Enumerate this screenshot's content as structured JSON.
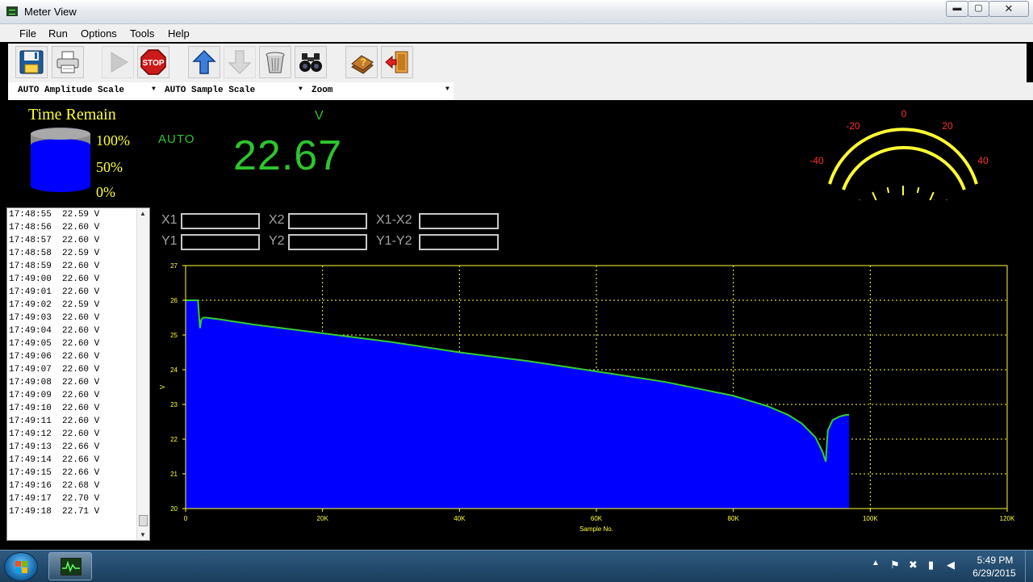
{
  "window": {
    "title": "Meter View",
    "minimize": "▬",
    "maximize": "▢",
    "close": "✕"
  },
  "menu": [
    "File",
    "Run",
    "Options",
    "Tools",
    "Help"
  ],
  "toolbar": [
    {
      "name": "save-button",
      "icon": "floppy-disk-icon",
      "enabled": true
    },
    {
      "name": "print-button",
      "icon": "printer-icon",
      "enabled": true
    },
    {
      "name": "play-button",
      "icon": "play-icon",
      "enabled": false
    },
    {
      "name": "stop-button",
      "icon": "stop-sign-icon",
      "enabled": true,
      "label": "STOP"
    },
    {
      "name": "upload-button",
      "icon": "arrow-up-icon",
      "enabled": true
    },
    {
      "name": "download-button",
      "icon": "arrow-down-icon",
      "enabled": false
    },
    {
      "name": "clear-button",
      "icon": "trash-can-icon",
      "enabled": true
    },
    {
      "name": "find-button",
      "icon": "binoculars-icon",
      "enabled": true
    },
    {
      "name": "help-book-button",
      "icon": "help-book-icon",
      "enabled": true
    },
    {
      "name": "exit-button",
      "icon": "exit-door-icon",
      "enabled": true
    }
  ],
  "scales": {
    "amplitude": "AUTO Amplitude Scale",
    "sample": "AUTO Sample Scale",
    "zoom": "Zoom"
  },
  "meter": {
    "time_remain_label": "Time Remain",
    "tank_levels": [
      "100%",
      "50%",
      "0%"
    ],
    "mode": "AUTO",
    "unit": "V",
    "reading": "22.67",
    "gauge_ticks": [
      "-40",
      "-20",
      "0",
      "20",
      "40"
    ],
    "gauge_value": 22.67
  },
  "log": [
    "17:48:55  22.59 V",
    "17:48:56  22.60 V",
    "17:48:57  22.60 V",
    "17:48:58  22.59 V",
    "17:48:59  22.60 V",
    "17:49:00  22.60 V",
    "17:49:01  22.60 V",
    "17:49:02  22.59 V",
    "17:49:03  22.60 V",
    "17:49:04  22.60 V",
    "17:49:05  22.60 V",
    "17:49:06  22.60 V",
    "17:49:07  22.60 V",
    "17:49:08  22.60 V",
    "17:49:09  22.60 V",
    "17:49:10  22.60 V",
    "17:49:11  22.60 V",
    "17:49:12  22.60 V",
    "17:49:13  22.66 V",
    "17:49:14  22.66 V",
    "17:49:15  22.66 V",
    "17:49:16  22.68 V",
    "17:49:17  22.70 V",
    "17:49:18  22.71 V"
  ],
  "cursors": {
    "x1": "X1",
    "x2": "X2",
    "x1x2": "X1-X2",
    "y1": "Y1",
    "y2": "Y2",
    "y1y2": "Y1-Y2"
  },
  "chart_data": {
    "type": "area",
    "xlabel": "Sample No.",
    "ylabel": "V",
    "xlim": [
      0,
      120000
    ],
    "ylim": [
      20,
      27
    ],
    "x_ticks": [
      "0",
      "20K",
      "40K",
      "60K",
      "80K",
      "100K",
      "120K"
    ],
    "y_ticks": [
      "20",
      "21",
      "22",
      "23",
      "24",
      "25",
      "26",
      "27"
    ],
    "grid": true,
    "fill_color": "#0000ff",
    "line_color": "#33cc33",
    "axis_color": "#ffff33",
    "x": [
      0,
      1800,
      2100,
      2300,
      2600,
      3000,
      5000,
      10000,
      20000,
      30000,
      40000,
      50000,
      60000,
      70000,
      80000,
      85000,
      88000,
      90000,
      92000,
      93000,
      93500,
      93800,
      94500,
      95500,
      96500,
      96900
    ],
    "y": [
      26.0,
      26.0,
      25.2,
      25.45,
      25.5,
      25.5,
      25.45,
      25.3,
      25.05,
      24.8,
      24.5,
      24.25,
      23.95,
      23.65,
      23.25,
      22.95,
      22.7,
      22.45,
      22.05,
      21.65,
      21.35,
      22.25,
      22.55,
      22.65,
      22.7,
      22.7
    ]
  },
  "taskbar": {
    "time": "5:49 PM",
    "date": "6/29/2015"
  }
}
